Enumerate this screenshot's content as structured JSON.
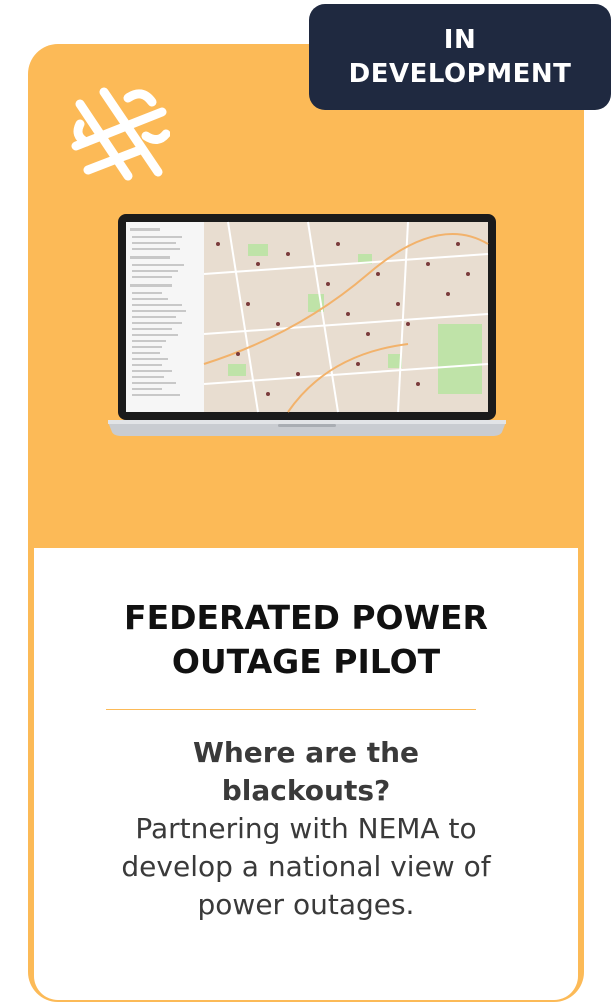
{
  "badge": {
    "line1": "IN",
    "line2": "DEVELOPMENT"
  },
  "card": {
    "logo_icon": "crossed-lines-logo",
    "screenshot_icon": "laptop-map-icon",
    "title_line1": "FEDERATED POWER",
    "title_line2": "OUTAGE PILOT",
    "question_line1": "Where are the",
    "question_line2": "blackouts?",
    "desc_line1": "Partnering with NEMA to",
    "desc_line2": "develop a national view of",
    "desc_line3": "power outages."
  },
  "colors": {
    "card_accent": "#FCBA57",
    "badge_bg": "#1F2940",
    "text_dark": "#111111",
    "text_body": "#3a3a3a"
  }
}
